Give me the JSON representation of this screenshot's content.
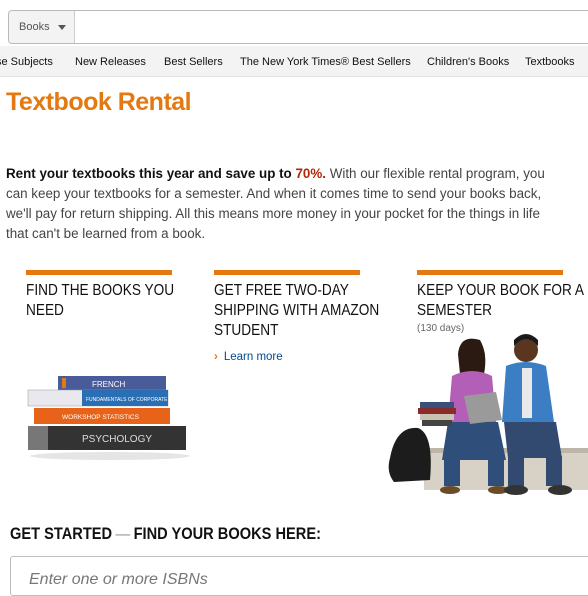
{
  "search": {
    "category": "Books",
    "value": ""
  },
  "nav": {
    "items": [
      "se Subjects",
      "New Releases",
      "Best Sellers",
      "The New York Times® Best Sellers",
      "Children's Books",
      "Textbooks"
    ]
  },
  "page": {
    "title": "Textbook Rental",
    "intro": {
      "lead": "Rent your textbooks this year and save up to ",
      "percent": "70%.",
      "body": " With our flexible rental program, you can keep your textbooks for a semester. And when it comes time to send your books back, we'll pay for return shipping. All this means more money in your pocket for the things in life that can't be learned from a book."
    }
  },
  "columns": [
    {
      "heading": "Find the books you need"
    },
    {
      "heading": "Get free two-day shipping with Amazon Student",
      "link": "Learn more"
    },
    {
      "heading": "Keep your book for a semester",
      "sub": "(130 days)"
    }
  ],
  "books_illustration": {
    "titles": [
      "FRENCH",
      "FUNDAMENTALS OF CORPORATE FINANCE",
      "WORKSHOP STATISTICS",
      "PSYCHOLOGY"
    ]
  },
  "get_started": {
    "label": "GET STARTED",
    "dash": "—",
    "rest": "FIND YOUR BOOKS HERE:",
    "isbn_placeholder": "Enter one or more ISBNs"
  },
  "colors": {
    "accent": "#e47911",
    "link": "#004b91",
    "price": "#b12704"
  }
}
